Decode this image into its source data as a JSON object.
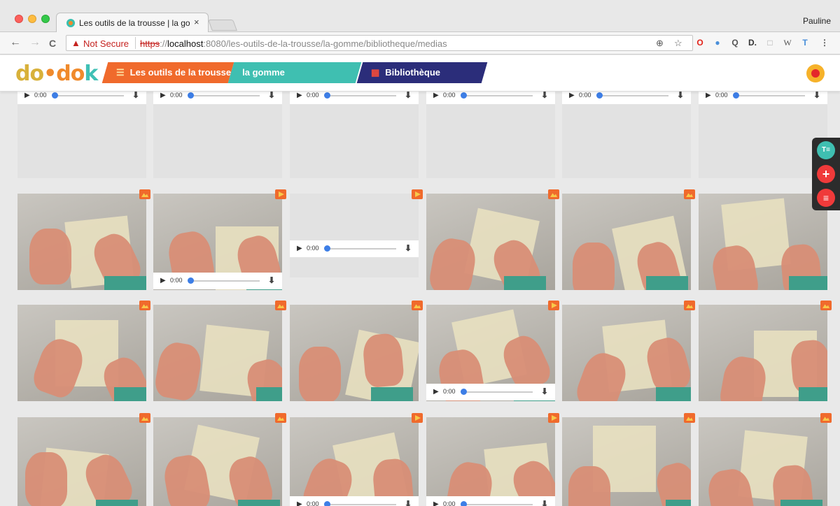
{
  "browser": {
    "tab_title": "Les outils de la trousse | la go",
    "tab_close": "×",
    "profile_name": "Pauline",
    "address": {
      "security_label": "Not Secure",
      "protocol": "https",
      "host": "localhost",
      "path": ":8080/les-outils-de-la-trousse/la-gomme/bibliotheque/medias"
    },
    "nav": {
      "back": "←",
      "forward": "→",
      "reload": "C"
    },
    "omni_icons": {
      "zoom": "⊕",
      "star": "☆"
    },
    "extensions": [
      "O",
      "●",
      "Q",
      "D.",
      "□",
      "W",
      "T",
      "⋮"
    ]
  },
  "app": {
    "logo": {
      "part1": "do",
      "dot": "•",
      "part2": "do",
      "part3": "k"
    },
    "breadcrumbs": [
      {
        "label": "Les outils de la trousse",
        "icon": "menu-icon",
        "color": "#f06a2c"
      },
      {
        "label": "la gomme",
        "color": "#3fbfb1"
      },
      {
        "label": "Bibliothèque",
        "icon": "grid-icon",
        "color": "#2b2d7a"
      }
    ],
    "rail": [
      {
        "icon": "text-icon",
        "glyph": "T≡"
      },
      {
        "icon": "add-icon",
        "glyph": "+"
      },
      {
        "icon": "list-icon",
        "glyph": "≡"
      }
    ]
  },
  "player": {
    "play_glyph": "▶",
    "time": "0:00",
    "download_glyph": "⬇"
  },
  "media": [
    {
      "type": "audio"
    },
    {
      "type": "audio"
    },
    {
      "type": "audio"
    },
    {
      "type": "audio"
    },
    {
      "type": "audio"
    },
    {
      "type": "audio"
    },
    {
      "type": "image"
    },
    {
      "type": "video"
    },
    {
      "type": "video-audio"
    },
    {
      "type": "image"
    },
    {
      "type": "image"
    },
    {
      "type": "image"
    },
    {
      "type": "image"
    },
    {
      "type": "image"
    },
    {
      "type": "image"
    },
    {
      "type": "video"
    },
    {
      "type": "image"
    },
    {
      "type": "image"
    },
    {
      "type": "image"
    },
    {
      "type": "image"
    },
    {
      "type": "video"
    },
    {
      "type": "video"
    },
    {
      "type": "image"
    },
    {
      "type": "image"
    }
  ]
}
